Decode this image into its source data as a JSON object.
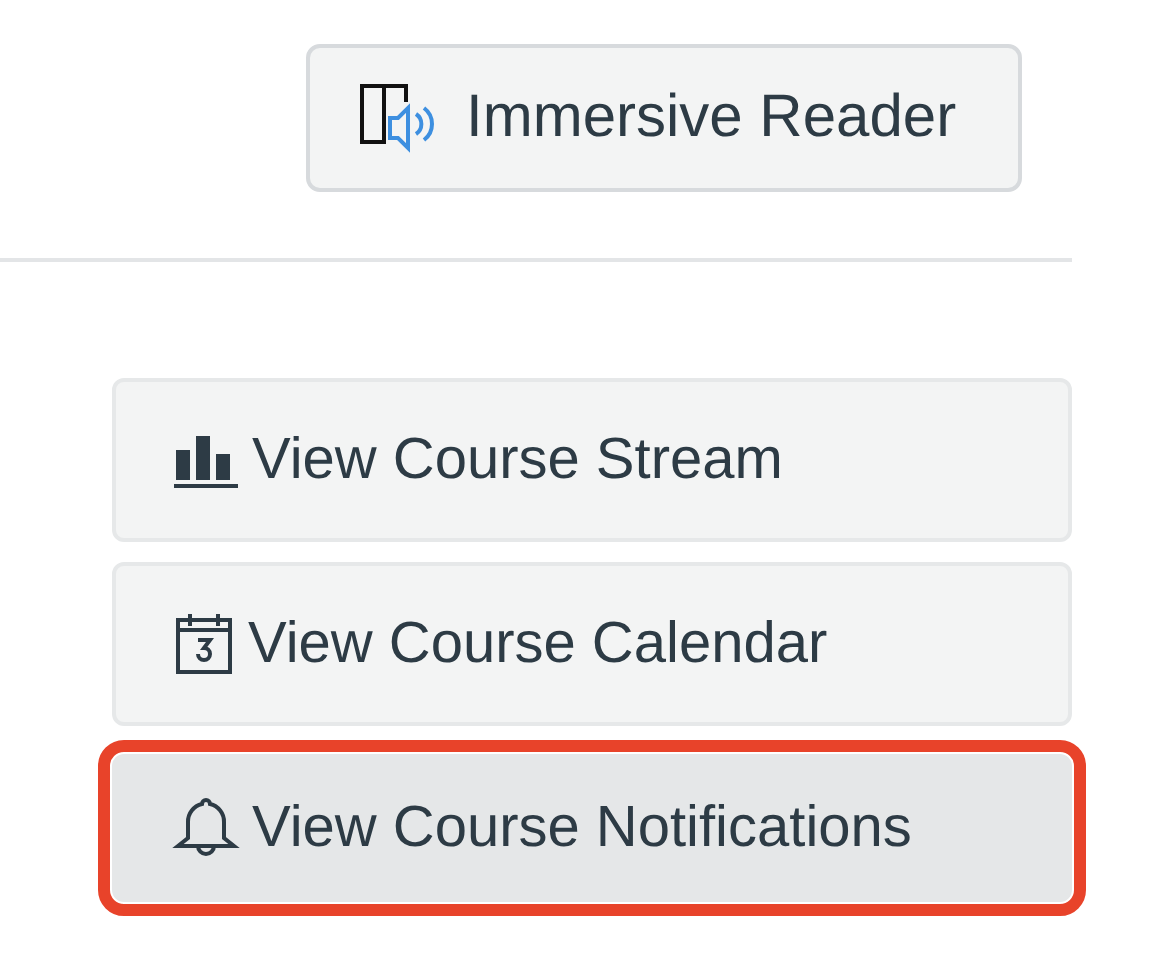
{
  "reader_button": {
    "label": "Immersive Reader"
  },
  "course_buttons": [
    {
      "kind": "stream",
      "label": "View Course Stream",
      "highlighted": false
    },
    {
      "kind": "calendar",
      "label": "View Course Calendar",
      "highlighted": false
    },
    {
      "kind": "notifications",
      "label": "View Course Notifications",
      "highlighted": true
    }
  ]
}
